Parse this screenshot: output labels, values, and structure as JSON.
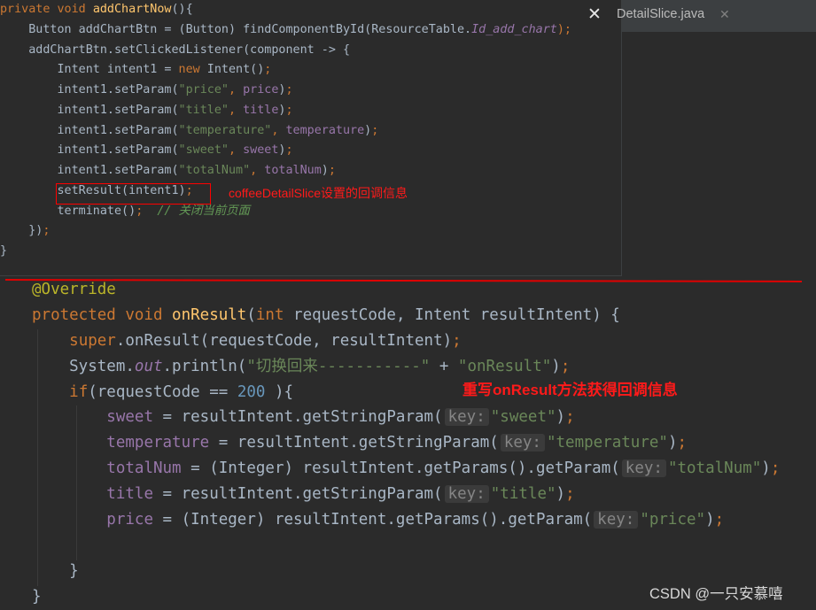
{
  "editor": {
    "tab_label": "DetailSlice.java",
    "tab_close_glyph": "✕",
    "close_glyph": "✕"
  },
  "top_snippet": {
    "lines": [
      [
        {
          "t": "private void ",
          "c": "k"
        },
        {
          "t": "addChartNow",
          "c": "f"
        },
        {
          "t": "(){",
          "c": ""
        }
      ],
      [
        {
          "t": "    Button addChartBtn = (Button) findComponentById(ResourceTable.",
          "c": ""
        },
        {
          "t": "Id_add_chart",
          "c": "pi"
        },
        {
          "t": ");",
          "c": "k"
        }
      ],
      [
        {
          "t": "    addChartBtn.setClickedListener(component -> {",
          "c": ""
        }
      ],
      [
        {
          "t": "        Intent intent1 = ",
          "c": ""
        },
        {
          "t": "new ",
          "c": "k"
        },
        {
          "t": "Intent()",
          "c": ""
        },
        {
          "t": ";",
          "c": "k"
        }
      ],
      [
        {
          "t": "        intent1.setParam(",
          "c": ""
        },
        {
          "t": "\"price\"",
          "c": "s"
        },
        {
          "t": ", ",
          "c": "k"
        },
        {
          "t": "price",
          "c": "p"
        },
        {
          "t": ")",
          "c": ""
        },
        {
          "t": ";",
          "c": "k"
        }
      ],
      [
        {
          "t": "        intent1.setParam(",
          "c": ""
        },
        {
          "t": "\"title\"",
          "c": "s"
        },
        {
          "t": ", ",
          "c": "k"
        },
        {
          "t": "title",
          "c": "p"
        },
        {
          "t": ")",
          "c": ""
        },
        {
          "t": ";",
          "c": "k"
        }
      ],
      [
        {
          "t": "        intent1.setParam(",
          "c": ""
        },
        {
          "t": "\"temperature\"",
          "c": "s"
        },
        {
          "t": ", ",
          "c": "k"
        },
        {
          "t": "temperature",
          "c": "p"
        },
        {
          "t": ")",
          "c": ""
        },
        {
          "t": ";",
          "c": "k"
        }
      ],
      [
        {
          "t": "        intent1.setParam(",
          "c": ""
        },
        {
          "t": "\"sweet\"",
          "c": "s"
        },
        {
          "t": ", ",
          "c": "k"
        },
        {
          "t": "sweet",
          "c": "p"
        },
        {
          "t": ")",
          "c": ""
        },
        {
          "t": ";",
          "c": "k"
        }
      ],
      [
        {
          "t": "        intent1.setParam(",
          "c": ""
        },
        {
          "t": "\"totalNum\"",
          "c": "s"
        },
        {
          "t": ", ",
          "c": "k"
        },
        {
          "t": "totalNum",
          "c": "p"
        },
        {
          "t": ")",
          "c": ""
        },
        {
          "t": ";",
          "c": "k"
        }
      ],
      [
        {
          "t": "        setResult(intent1)",
          "c": ""
        },
        {
          "t": ";",
          "c": "k"
        }
      ],
      [
        {
          "t": "        terminate()",
          "c": ""
        },
        {
          "t": ";  ",
          "c": "k"
        },
        {
          "t": "// 关闭当前页面",
          "c": "c"
        }
      ],
      [
        {
          "t": "    })",
          "c": ""
        },
        {
          "t": ";",
          "c": "k"
        }
      ],
      [
        {
          "t": "}",
          "c": ""
        }
      ]
    ]
  },
  "bottom_snippet": {
    "lines": [
      [
        {
          "t": "@Override",
          "c": "a"
        }
      ],
      [
        {
          "t": "protected void ",
          "c": "k"
        },
        {
          "t": "onResult",
          "c": "f"
        },
        {
          "t": "(",
          "c": ""
        },
        {
          "t": "int ",
          "c": "k"
        },
        {
          "t": "requestCode, Intent resultIntent) {",
          "c": ""
        }
      ],
      [
        {
          "t": "    ",
          "c": ""
        },
        {
          "t": "super",
          "c": "k"
        },
        {
          "t": ".onResult(requestCode, resultIntent)",
          "c": ""
        },
        {
          "t": ";",
          "c": "k"
        }
      ],
      [
        {
          "t": "    System.",
          "c": ""
        },
        {
          "t": "out",
          "c": "pi"
        },
        {
          "t": ".println(",
          "c": ""
        },
        {
          "t": "\"切换回来-----------\"",
          "c": "s"
        },
        {
          "t": " + ",
          "c": ""
        },
        {
          "t": "\"onResult\"",
          "c": "s"
        },
        {
          "t": ")",
          "c": ""
        },
        {
          "t": ";",
          "c": "k"
        }
      ],
      [
        {
          "t": "    ",
          "c": ""
        },
        {
          "t": "if",
          "c": "k"
        },
        {
          "t": "(requestCode == ",
          "c": ""
        },
        {
          "t": "200",
          "c": "n"
        },
        {
          "t": " ){",
          "c": ""
        }
      ],
      [
        {
          "t": "        ",
          "c": ""
        },
        {
          "t": "sweet",
          "c": "p"
        },
        {
          "t": " = resultIntent.getStringParam(",
          "c": ""
        },
        {
          "t": "key:",
          "c": "hint"
        },
        {
          "t": "\"sweet\"",
          "c": "s"
        },
        {
          "t": ")",
          "c": ""
        },
        {
          "t": ";",
          "c": "k"
        }
      ],
      [
        {
          "t": "        ",
          "c": ""
        },
        {
          "t": "temperature",
          "c": "p"
        },
        {
          "t": " = resultIntent.getStringParam(",
          "c": ""
        },
        {
          "t": "key:",
          "c": "hint"
        },
        {
          "t": "\"temperature\"",
          "c": "s"
        },
        {
          "t": ")",
          "c": ""
        },
        {
          "t": ";",
          "c": "k"
        }
      ],
      [
        {
          "t": "        ",
          "c": ""
        },
        {
          "t": "totalNum",
          "c": "p"
        },
        {
          "t": " = (Integer) resultIntent.getParams().getParam(",
          "c": ""
        },
        {
          "t": "key:",
          "c": "hint"
        },
        {
          "t": "\"totalNum\"",
          "c": "s"
        },
        {
          "t": ")",
          "c": ""
        },
        {
          "t": ";",
          "c": "k"
        }
      ],
      [
        {
          "t": "        ",
          "c": ""
        },
        {
          "t": "title",
          "c": "p"
        },
        {
          "t": " = resultIntent.getStringParam(",
          "c": ""
        },
        {
          "t": "key:",
          "c": "hint"
        },
        {
          "t": "\"title\"",
          "c": "s"
        },
        {
          "t": ")",
          "c": ""
        },
        {
          "t": ";",
          "c": "k"
        }
      ],
      [
        {
          "t": "        ",
          "c": ""
        },
        {
          "t": "price",
          "c": "p"
        },
        {
          "t": " = (Integer) resultIntent.getParams().getParam(",
          "c": ""
        },
        {
          "t": "key:",
          "c": "hint"
        },
        {
          "t": "\"price\"",
          "c": "s"
        },
        {
          "t": ")",
          "c": ""
        },
        {
          "t": ";",
          "c": "k"
        }
      ],
      [
        {
          "t": "",
          "c": ""
        }
      ],
      [
        {
          "t": "    }",
          "c": ""
        }
      ],
      [
        {
          "t": "}",
          "c": ""
        }
      ]
    ]
  },
  "annotations": {
    "callback_info": "coffeeDetailSlice设置的回调信息",
    "override_info": "重写onResult方法获得回调信息"
  },
  "watermark": "CSDN @一只安慕嘻",
  "colors": {
    "background": "#2b2b2b",
    "keyword": "#cc7832",
    "string": "#6a8759",
    "method": "#ffc66d",
    "field": "#9876aa",
    "number": "#6897bb",
    "comment": "#629755",
    "annotation_red": "#ff0000"
  }
}
